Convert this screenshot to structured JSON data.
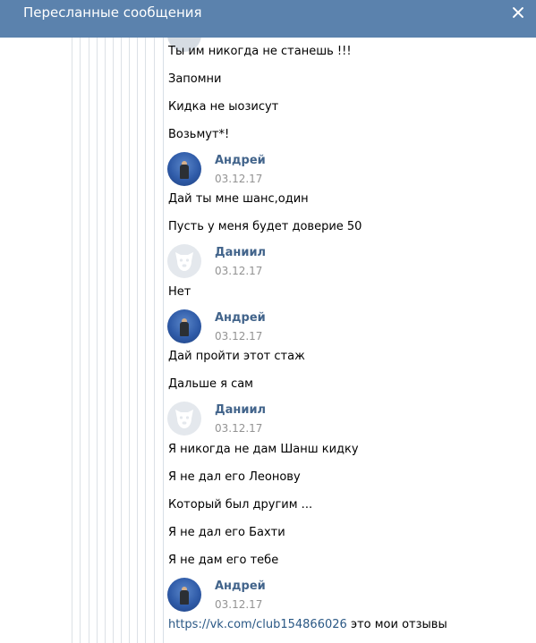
{
  "header": {
    "title": "Пересланные сообщения"
  },
  "messages": [
    {
      "type": "text",
      "text": "Ты им никогда не станешь !!!"
    },
    {
      "type": "text",
      "text": "Запомни"
    },
    {
      "type": "text",
      "text": "Кидка не ыозисут"
    },
    {
      "type": "text",
      "text": "Возьмут*!"
    },
    {
      "type": "author",
      "name": "Андрей",
      "date": "03.12.17",
      "avatar": "photo"
    },
    {
      "type": "text",
      "text": "Дай ты мне шанс,один"
    },
    {
      "type": "text",
      "text": "Пусть у меня будет доверие 50"
    },
    {
      "type": "author",
      "name": "Даниил",
      "date": "03.12.17",
      "avatar": "dog-icon"
    },
    {
      "type": "text",
      "text": "Нет"
    },
    {
      "type": "author",
      "name": "Андрей",
      "date": "03.12.17",
      "avatar": "photo"
    },
    {
      "type": "text",
      "text": "Дай пройти этот стаж"
    },
    {
      "type": "text",
      "text": "Дальше я сам"
    },
    {
      "type": "author",
      "name": "Даниил",
      "date": "03.12.17",
      "avatar": "dog-icon"
    },
    {
      "type": "text",
      "text": "Я никогда не дам Шанш кидку"
    },
    {
      "type": "text",
      "text": "Я не дал его Леонову"
    },
    {
      "type": "text",
      "text": "Который был другим ..."
    },
    {
      "type": "text",
      "text": "Я не дал его Бахти"
    },
    {
      "type": "text",
      "text": "Я не дам его тебе"
    },
    {
      "type": "author",
      "name": "Андрей",
      "date": "03.12.17",
      "avatar": "photo"
    },
    {
      "type": "link",
      "url": "https://vk.com/club154866026",
      "text": "это мои отзывы"
    }
  ],
  "colors": {
    "header_bg": "#5b82ad",
    "author": "#42648b",
    "link": "#2a5885",
    "date": "#939393"
  }
}
